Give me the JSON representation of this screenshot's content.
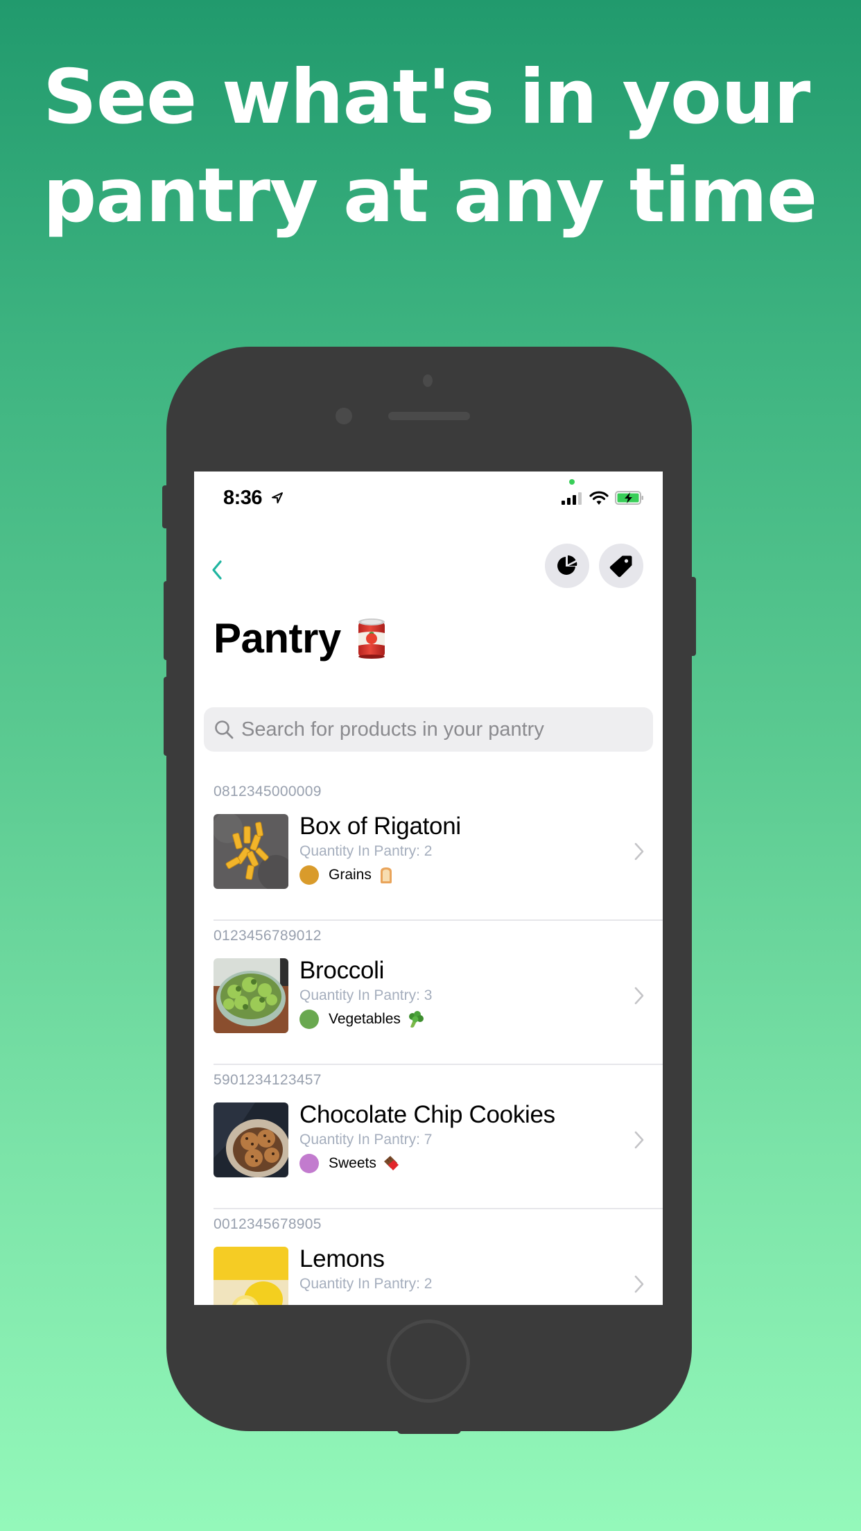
{
  "headline": {
    "line1": "See what's in your",
    "line2": "pantry at any time"
  },
  "status_bar": {
    "time": "8:36",
    "location_icon": "location-arrow-icon",
    "signal_icon": "cellular-signal-icon",
    "wifi_icon": "wifi-icon",
    "battery_icon": "battery-charging-icon",
    "battery_color": "#38CE58"
  },
  "nav": {
    "back_icon": "chevron-left-icon",
    "accent_color": "#1FB5A0",
    "actions": [
      {
        "name": "stats",
        "icon": "pie-chart-icon"
      },
      {
        "name": "categories",
        "icon": "tag-icon"
      }
    ]
  },
  "page": {
    "title": "Pantry",
    "title_emoji": "canned-food-icon"
  },
  "search": {
    "placeholder": "Search for products in your pantry",
    "value": ""
  },
  "products": [
    {
      "barcode": "0812345000009",
      "name": "Box of Rigatoni",
      "quantity": "Quantity In Pantry: 2",
      "category": "Grains",
      "category_emoji": "bread-icon",
      "category_color": "#D99B2B",
      "image": "rigatoni-photo"
    },
    {
      "barcode": "0123456789012",
      "name": "Broccoli",
      "quantity": "Quantity In Pantry: 3",
      "category": "Vegetables",
      "category_emoji": "broccoli-icon",
      "category_color": "#69A84F",
      "image": "broccoli-photo"
    },
    {
      "barcode": "5901234123457",
      "name": "Chocolate Chip Cookies",
      "quantity": "Quantity In Pantry: 7",
      "category": "Sweets",
      "category_emoji": "chocolate-bar-icon",
      "category_color": "#C27BCE",
      "image": "cookies-photo"
    },
    {
      "barcode": "0012345678905",
      "name": "Lemons",
      "quantity": "Quantity In Pantry: 2",
      "category": "",
      "category_emoji": "",
      "category_color": "",
      "image": "lemons-photo"
    }
  ]
}
